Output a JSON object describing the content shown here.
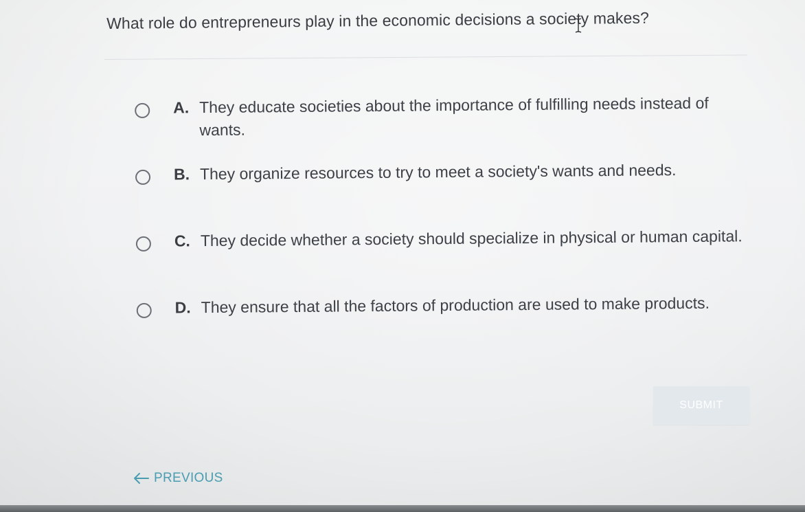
{
  "question": {
    "text_before": "What role do entrepreneurs play in the economic decision",
    "text_after": "s a society makes?"
  },
  "choices": [
    {
      "letter": "A.",
      "text": "They educate societies about the importance of fulfilling needs instead of wants."
    },
    {
      "letter": "B.",
      "text": "They organize resources to try to meet a society's wants and needs."
    },
    {
      "letter": "C.",
      "text": "They decide whether a society should specialize in physical or human capital."
    },
    {
      "letter": "D.",
      "text": "They ensure that all the factors of production are used to make products."
    }
  ],
  "submit_label": "SUBMIT",
  "previous_label": "PREVIOUS",
  "colors": {
    "link": "#4a9db0",
    "submit_bg": "#e2e8ec",
    "text": "#3c3f44"
  },
  "icons": {
    "previous": "arrow-left-icon",
    "cursor": "text-cursor-icon",
    "radio": "radio-button-icon"
  }
}
